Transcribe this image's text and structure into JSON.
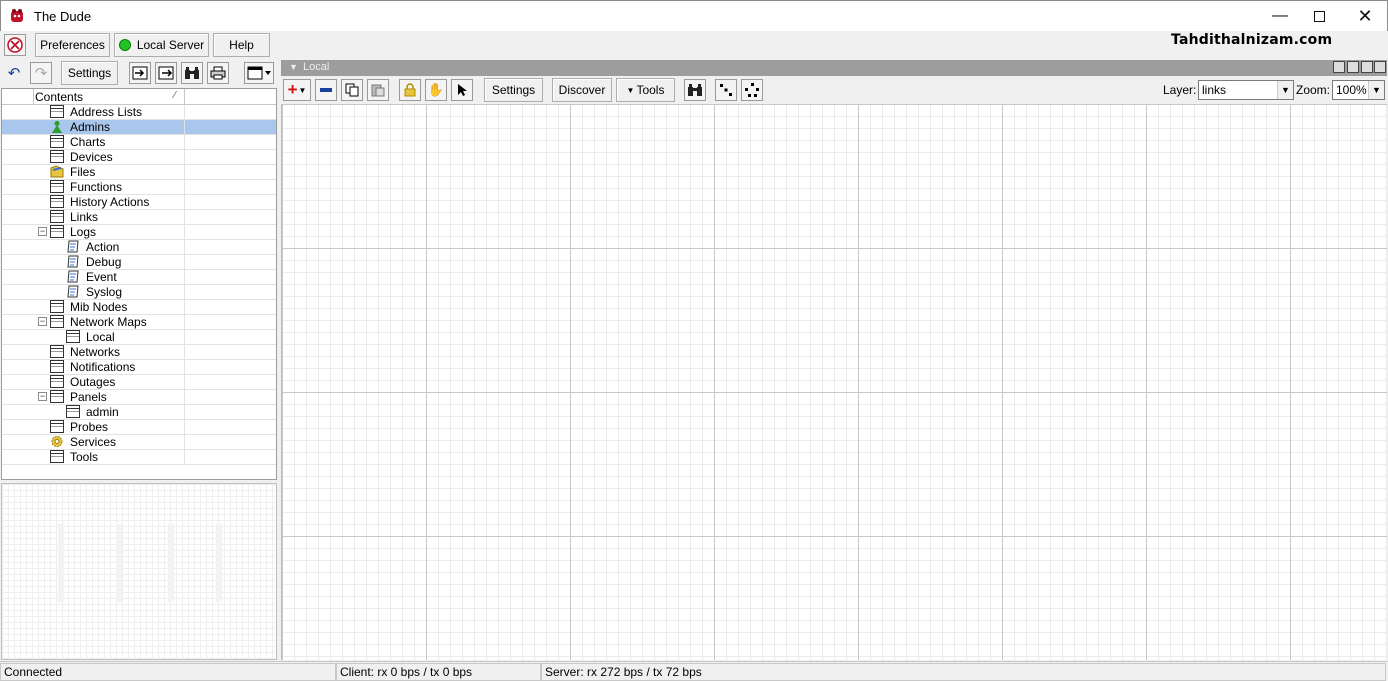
{
  "window": {
    "title": "The Dude"
  },
  "toolbar1": {
    "preferences": "Preferences",
    "local_server": "Local Server",
    "help": "Help"
  },
  "toolbar2": {
    "settings": "Settings"
  },
  "watermark": "Tahdithalnizam.com",
  "tree": {
    "header": "Contents",
    "items": [
      {
        "label": "Address Lists",
        "icon": "table-icon"
      },
      {
        "label": "Admins",
        "icon": "admin-icon"
      },
      {
        "label": "Charts",
        "icon": "table-icon"
      },
      {
        "label": "Devices",
        "icon": "table-icon"
      },
      {
        "label": "Files",
        "icon": "files-icon"
      },
      {
        "label": "Functions",
        "icon": "table-icon"
      },
      {
        "label": "History Actions",
        "icon": "table-icon"
      },
      {
        "label": "Links",
        "icon": "table-icon"
      },
      {
        "label": "Logs",
        "icon": "table-icon"
      },
      {
        "label": "Action",
        "icon": "log-icon"
      },
      {
        "label": "Debug",
        "icon": "log-icon"
      },
      {
        "label": "Event",
        "icon": "log-icon"
      },
      {
        "label": "Syslog",
        "icon": "log-icon"
      },
      {
        "label": "Mib Nodes",
        "icon": "table-icon"
      },
      {
        "label": "Network Maps",
        "icon": "table-icon"
      },
      {
        "label": "Local",
        "icon": "table-icon"
      },
      {
        "label": "Networks",
        "icon": "table-icon"
      },
      {
        "label": "Notifications",
        "icon": "table-icon"
      },
      {
        "label": "Outages",
        "icon": "table-icon"
      },
      {
        "label": "Panels",
        "icon": "table-icon"
      },
      {
        "label": "admin",
        "icon": "table-icon"
      },
      {
        "label": "Probes",
        "icon": "table-icon"
      },
      {
        "label": "Services",
        "icon": "gear-icon"
      },
      {
        "label": "Tools",
        "icon": "table-icon"
      }
    ],
    "selected": "Admins"
  },
  "map": {
    "title": "Local",
    "settings": "Settings",
    "discover": "Discover",
    "tools": "Tools",
    "layer_label": "Layer:",
    "layer_value": "links",
    "zoom_label": "Zoom:",
    "zoom_value": "100%"
  },
  "status": {
    "connection": "Connected",
    "client": "Client: rx 0 bps / tx 0 bps",
    "server": "Server: rx 272 bps / tx 72 bps"
  },
  "colors": {
    "selection": "#a9c6ec",
    "status_ok": "#22c322",
    "add_red": "#d01010",
    "remove_blue": "#1b3f9c"
  }
}
